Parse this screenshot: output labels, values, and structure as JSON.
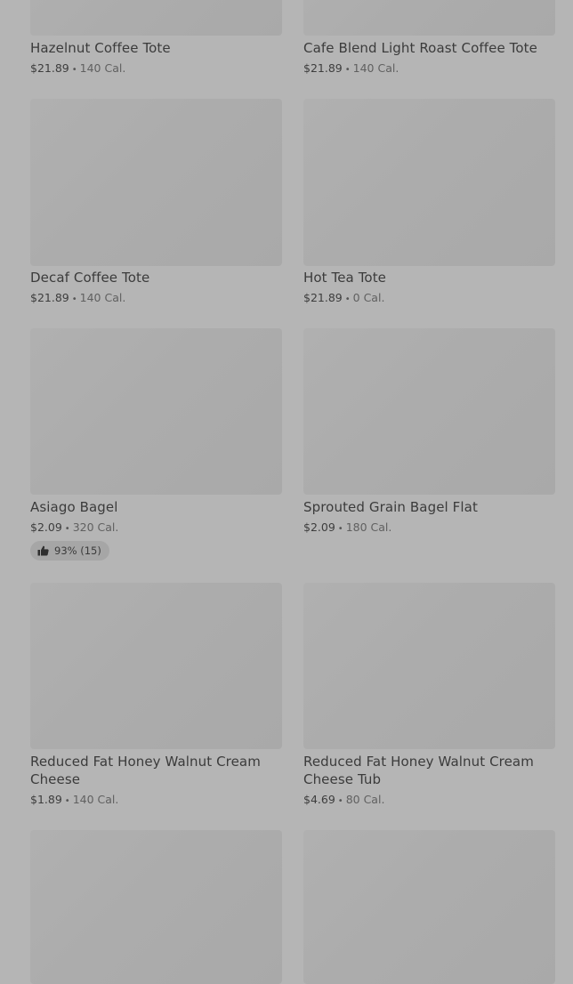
{
  "items": [
    {
      "name": "Hazelnut Coffee Tote",
      "price": "$21.89",
      "separator": "•",
      "calories": "140 Cal."
    },
    {
      "name": "Cafe Blend Light Roast Coffee Tote",
      "price": "$21.89",
      "separator": "•",
      "calories": "140 Cal."
    },
    {
      "name": "Decaf Coffee Tote",
      "price": "$21.89",
      "separator": "•",
      "calories": "140 Cal."
    },
    {
      "name": "Hot Tea Tote",
      "price": "$21.89",
      "separator": "•",
      "calories": "0 Cal."
    },
    {
      "name": "Asiago Bagel",
      "price": "$2.09",
      "separator": "•",
      "calories": "320 Cal.",
      "rating": "93% (15)"
    },
    {
      "name": "Sprouted Grain Bagel Flat",
      "price": "$2.09",
      "separator": "•",
      "calories": "180 Cal."
    },
    {
      "name": "Reduced Fat Honey Walnut Cream Cheese",
      "price": "$1.89",
      "separator": "•",
      "calories": "140 Cal."
    },
    {
      "name": "Reduced Fat Honey Walnut Cream Cheese Tub",
      "price": "$4.69",
      "separator": "•",
      "calories": "80 Cal."
    }
  ],
  "icons": {
    "rating": "thumbs-up-icon"
  }
}
